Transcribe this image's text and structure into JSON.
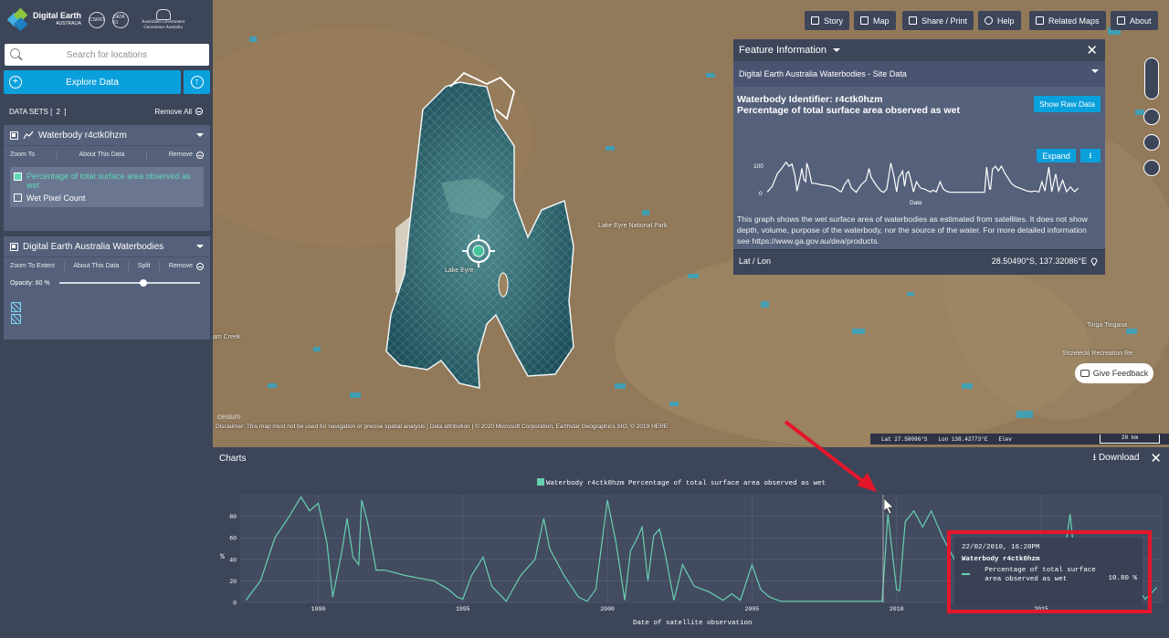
{
  "brand": {
    "name": "Digital Earth",
    "sub": "AUSTRALIA",
    "csiro": "CSIRO",
    "partner": "DATA 61",
    "gov_line1": "Australian Government",
    "gov_line2": "Geoscience Australia"
  },
  "search": {
    "placeholder": "Search for locations"
  },
  "explore_label": "Explore Data",
  "datasets": {
    "header": "DATA SETS",
    "count": "[ 2 ]",
    "remove_all": "Remove All",
    "items": [
      {
        "title": "Waterbody r4ctk0hzm",
        "actions": [
          "Zoom To",
          "About This Data",
          "Remove"
        ],
        "legend": [
          {
            "label": "Percentage of total surface area observed as wet",
            "color": "#5fd9b8"
          }
        ],
        "extra": "Wet Pixel Count"
      },
      {
        "title": "Digital Earth Australia Waterbodies",
        "actions": [
          "Zoom To Extent",
          "About This Data",
          "Split",
          "Remove"
        ],
        "opacity_label": "Opacity: 60 %",
        "opacity": 0.6
      }
    ]
  },
  "topnav": [
    "Story",
    "Map",
    "Share / Print",
    "Help",
    "Related Maps",
    "About"
  ],
  "map": {
    "labels": [
      "Lake Eyre National Park",
      "Lake Eyre",
      "am Creek",
      "Tinga Tingana",
      "Strzelecki Recreation Re"
    ],
    "disclaimer": "Disclaimer: This map must not be used for navigation or precise spatial analysis | Data attribution | © 2020 Microsoft Corporation, Earthstar Geographics SIO, © 2019 HERE",
    "cesium": "cesium",
    "lat": "Lat  27.50096°S",
    "lon": "Lon  138.42773°E",
    "elev": "Elev",
    "scale": "20 km",
    "feedback": "Give Feedback"
  },
  "feature": {
    "title": "Feature Information",
    "source": "Digital Earth Australia Waterbodies - Site Data",
    "identifier": "Waterbody Identifier: r4ctk0hzm",
    "metric": "Percentage of total surface area observed as wet",
    "show_raw": "Show Raw Data",
    "expand": "Expand",
    "mini_y_top": "100",
    "mini_y_bottom": "0",
    "mini_x_label": "Date",
    "description": "This graph shows the wet surface area of waterbodies as estimated from satellites. It does not show depth, volume, purpose of the waterbody, nor the source of the water. For more detailed information see https://www.ga.gov.au/dea/products.",
    "latlon_label": "Lat / Lon",
    "latlon_value": "28.50490°S, 137.32086°E"
  },
  "charts": {
    "title": "Charts",
    "download": "Download"
  },
  "tooltip": {
    "date": "22/02/2010, 16:20PM",
    "series": "Waterbody r4ctk0hzm",
    "label": "Percentage of total surface area observed as wet",
    "value": "10.80 %"
  },
  "chart_data": {
    "type": "line",
    "legend": "Waterbody r4ctk0hzm Percentage of total surface area observed as wet",
    "xlabel": "Date of satellite observation",
    "ylabel": "%",
    "xlim": [
      1987.3,
      2019.2
    ],
    "ylim": [
      0,
      100
    ],
    "x_ticks": [
      "1990",
      "1995",
      "2000",
      "2005",
      "2010",
      "2015"
    ],
    "y_ticks": [
      "0",
      "20",
      "40",
      "60",
      "80"
    ],
    "color": "#66d1b0",
    "x": [
      1987.5,
      1988.0,
      1988.5,
      1989.0,
      1989.4,
      1989.7,
      1990.0,
      1990.3,
      1990.5,
      1990.8,
      1991.0,
      1991.2,
      1991.4,
      1991.5,
      1991.7,
      1992.0,
      1992.3,
      1993.0,
      1994.0,
      1994.5,
      1994.8,
      1995.0,
      1995.3,
      1995.7,
      1996.0,
      1996.5,
      1997.0,
      1997.5,
      1997.8,
      1998.0,
      1998.5,
      1999.0,
      1999.3,
      1999.6,
      2000.0,
      2000.3,
      2000.6,
      2000.8,
      2001.0,
      2001.2,
      2001.4,
      2001.6,
      2001.8,
      2002.0,
      2002.3,
      2002.6,
      2003.0,
      2003.5,
      2004.0,
      2004.3,
      2004.6,
      2005.0,
      2005.3,
      2005.6,
      2006.0,
      2006.3,
      2007.0,
      2007.5,
      2008.0,
      2008.5,
      2009.0,
      2009.5,
      2009.7,
      2010.0,
      2010.1,
      2010.3,
      2010.6,
      2010.9,
      2011.2,
      2011.6,
      2011.9,
      2012.2,
      2012.6,
      2013.0,
      2013.4,
      2013.8,
      2014.2,
      2014.6,
      2015.0,
      2015.3,
      2015.6,
      2016.0,
      2016.3,
      2016.7,
      2017.0,
      2017.4,
      2017.8,
      2018.2,
      2018.6,
      2019.0
    ],
    "y": [
      2,
      20,
      60,
      80,
      98,
      85,
      92,
      55,
      5,
      45,
      78,
      42,
      35,
      95,
      75,
      30,
      30,
      25,
      20,
      12,
      5,
      3,
      25,
      42,
      15,
      1,
      25,
      40,
      78,
      50,
      25,
      5,
      1,
      12,
      95,
      55,
      2,
      48,
      58,
      70,
      20,
      62,
      68,
      45,
      2,
      35,
      15,
      10,
      2,
      8,
      2,
      35,
      12,
      5,
      1,
      1,
      1,
      1,
      1,
      1,
      1,
      1,
      82,
      12,
      10.8,
      75,
      85,
      70,
      85,
      60,
      45,
      30,
      20,
      15,
      10,
      5,
      3,
      5,
      2,
      35,
      5,
      82,
      3,
      60,
      5,
      40,
      3,
      18,
      3,
      14
    ]
  }
}
